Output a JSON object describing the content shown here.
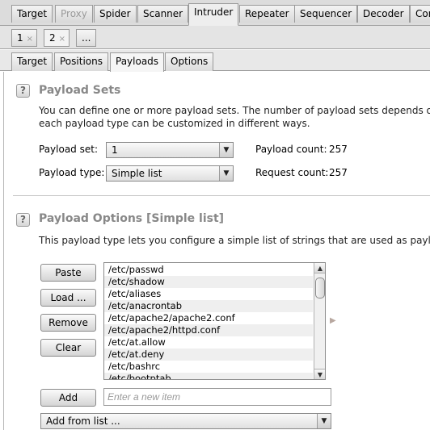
{
  "top_tabs": [
    "Target",
    "Proxy",
    "Spider",
    "Scanner",
    "Intruder",
    "Repeater",
    "Sequencer",
    "Decoder",
    "Com"
  ],
  "request_tabs": {
    "tab1": "1",
    "tab2": "2",
    "more": "...",
    "close_glyph": "×"
  },
  "inner_tabs": [
    "Target",
    "Positions",
    "Payloads",
    "Options"
  ],
  "payload_sets": {
    "title": "Payload Sets",
    "desc_line1": "You can define one or more payload sets. The number of payload sets depends on t",
    "desc_line2": "each payload type can be customized in different ways.",
    "set_label": "Payload set:",
    "set_value": "1",
    "type_label": "Payload type:",
    "type_value": "Simple list",
    "count_label": "Payload count:",
    "count_value": "257",
    "request_label": "Request count:",
    "request_value": "257"
  },
  "payload_options": {
    "title": "Payload Options [Simple list]",
    "desc": "This payload type lets you configure a simple list of strings that are used as payloac",
    "buttons": {
      "paste": "Paste",
      "load": "Load ...",
      "remove": "Remove",
      "clear": "Clear",
      "add": "Add"
    },
    "list_items": [
      "/etc/passwd",
      "/etc/shadow",
      "/etc/aliases",
      "/etc/anacrontab",
      "/etc/apache2/apache2.conf",
      "/etc/apache2/httpd.conf",
      "/etc/at.allow",
      "/etc/at.deny",
      "/etc/bashrc",
      "/etc/bootptab"
    ],
    "new_item_placeholder": "Enter a new item",
    "add_from_list": "Add from list ..."
  },
  "icons": {
    "help": "?",
    "dropdown": "▼",
    "scroll_up": "▲",
    "scroll_down": "▼",
    "expand": "▶"
  }
}
